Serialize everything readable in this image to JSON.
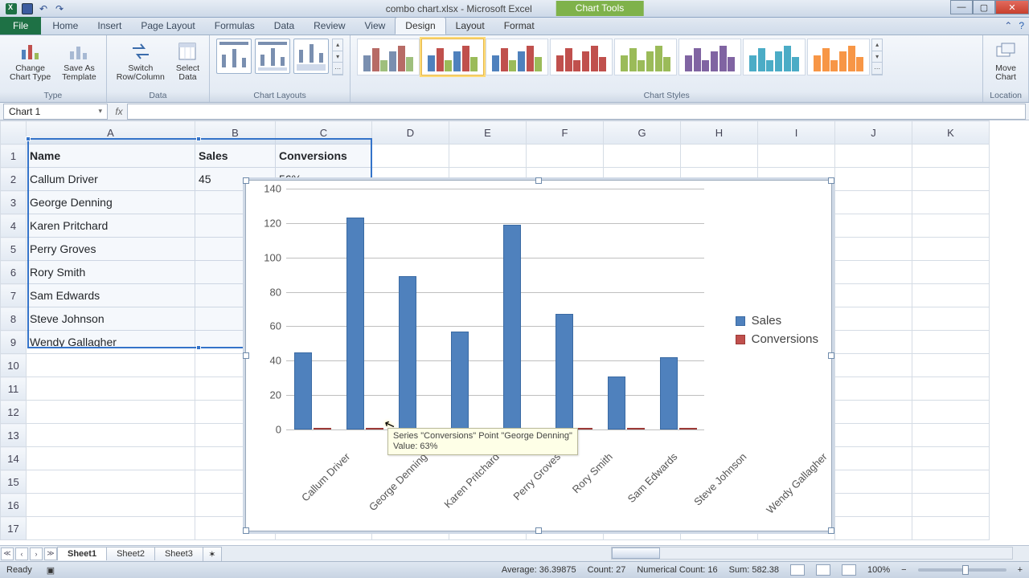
{
  "window": {
    "doc_title": "combo chart.xlsx - Microsoft Excel",
    "context_tab": "Chart Tools"
  },
  "tabs": {
    "file": "File",
    "home": "Home",
    "insert": "Insert",
    "pagelayout": "Page Layout",
    "formulas": "Formulas",
    "data": "Data",
    "review": "Review",
    "view": "View",
    "design": "Design",
    "layout": "Layout",
    "format": "Format"
  },
  "ribbon": {
    "type_group": "Type",
    "change_type": "Change\nChart Type",
    "save_template": "Save As\nTemplate",
    "data_group": "Data",
    "switch": "Switch\nRow/Column",
    "select": "Select\nData",
    "layouts_group": "Chart Layouts",
    "styles_group": "Chart Styles",
    "location_group": "Location",
    "move": "Move\nChart"
  },
  "namebox": "Chart 1",
  "sheet": {
    "headers": {
      "A": "Name",
      "B": "Sales",
      "C": "Conversions"
    },
    "rows": [
      {
        "name": "Callum Driver",
        "sales": "45",
        "conv": "56%"
      },
      {
        "name": "George Denning",
        "sales": "",
        "conv": ""
      },
      {
        "name": "Karen Pritchard",
        "sales": "",
        "conv": ""
      },
      {
        "name": "Perry Groves",
        "sales": "",
        "conv": ""
      },
      {
        "name": "Rory Smith",
        "sales": "",
        "conv": ""
      },
      {
        "name": "Sam Edwards",
        "sales": "",
        "conv": ""
      },
      {
        "name": "Steve Johnson",
        "sales": "",
        "conv": ""
      },
      {
        "name": "Wendy Gallagher",
        "sales": "",
        "conv": ""
      }
    ],
    "cols": [
      "A",
      "B",
      "C",
      "D",
      "E",
      "F",
      "G",
      "H",
      "I",
      "J",
      "K"
    ]
  },
  "tooltip": {
    "l1": "Series \"Conversions\" Point \"George Denning\"",
    "l2": "Value: 63%"
  },
  "legend": {
    "s1": "Sales",
    "s2": "Conversions"
  },
  "sheets": {
    "s1": "Sheet1",
    "s2": "Sheet2",
    "s3": "Sheet3"
  },
  "status": {
    "ready": "Ready",
    "avg": "Average: 36.39875",
    "count": "Count: 27",
    "ncount": "Numerical Count: 16",
    "sum": "Sum: 582.38",
    "zoom": "100%"
  },
  "chart_data": {
    "type": "bar",
    "categories": [
      "Callum Driver",
      "George Denning",
      "Karen Pritchard",
      "Perry Groves",
      "Rory Smith",
      "Sam Edwards",
      "Steve Johnson",
      "Wendy Gallagher"
    ],
    "series": [
      {
        "name": "Sales",
        "color": "#4f81bd",
        "values": [
          45,
          123,
          89,
          57,
          119,
          67,
          31,
          42
        ]
      },
      {
        "name": "Conversions",
        "color": "#c0504d",
        "values": [
          0.56,
          0.63,
          0.5,
          0.5,
          0.5,
          0.5,
          0.5,
          0.5
        ]
      }
    ],
    "ylim": [
      0,
      140
    ],
    "yticks": [
      0,
      20,
      40,
      60,
      80,
      100,
      120,
      140
    ],
    "xlabel": "",
    "ylabel": "",
    "title": ""
  },
  "style_palettes": [
    [
      "#7a8fb0",
      "#b76b66",
      "#9fbf7d"
    ],
    [
      "#4f81bd",
      "#c0504d",
      "#9bbb59"
    ],
    [
      "#4f81bd",
      "#c0504d",
      "#9bbb59"
    ],
    [
      "#c0504d",
      "#c0504d",
      "#c0504d"
    ],
    [
      "#9bbb59",
      "#9bbb59",
      "#9bbb59"
    ],
    [
      "#8064a2",
      "#8064a2",
      "#8064a2"
    ],
    [
      "#4bacc6",
      "#4bacc6",
      "#4bacc6"
    ],
    [
      "#f79646",
      "#f79646",
      "#f79646"
    ]
  ]
}
